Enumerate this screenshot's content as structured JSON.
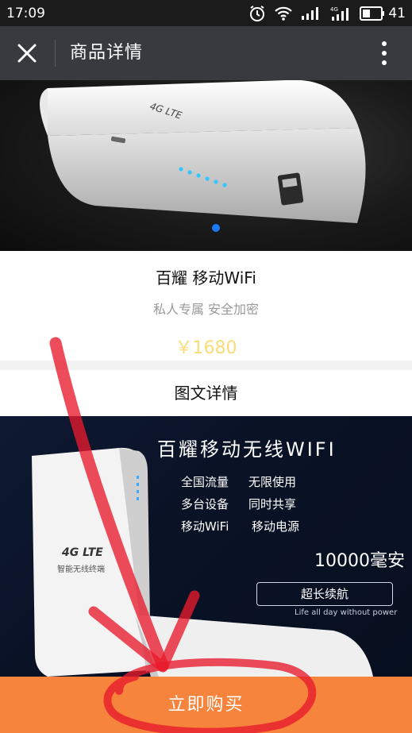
{
  "status_bar": {
    "time": "17:09",
    "battery": "41",
    "network_label": "4G"
  },
  "nav": {
    "title": "商品详情",
    "close_icon": "close-icon",
    "more_icon": "more-vertical-icon"
  },
  "product": {
    "name": "百耀 移动WiFi",
    "subtitle": "私人专属 安全加密",
    "price": "￥1680",
    "banner_logo": "4G LTE"
  },
  "detail": {
    "heading": "图文详情"
  },
  "poster": {
    "title": "百耀移动无线WIFI",
    "features": [
      "全国流量",
      "无限使用",
      "多台设备",
      "同时共享",
      "移动WiFi",
      "移动电源"
    ],
    "capacity": "10000毫安",
    "badge": "超长续航",
    "tagline": "Life all day without power",
    "device_logo": "4G LTE",
    "device_caption": "智能无线终端"
  },
  "buy_button": {
    "label": "立即购买"
  },
  "colors": {
    "accent_orange": "#f7843c",
    "price_yellow": "#f9dc7a",
    "indicator_blue": "#1e7bf5",
    "annotation_red": "#e8192c"
  }
}
